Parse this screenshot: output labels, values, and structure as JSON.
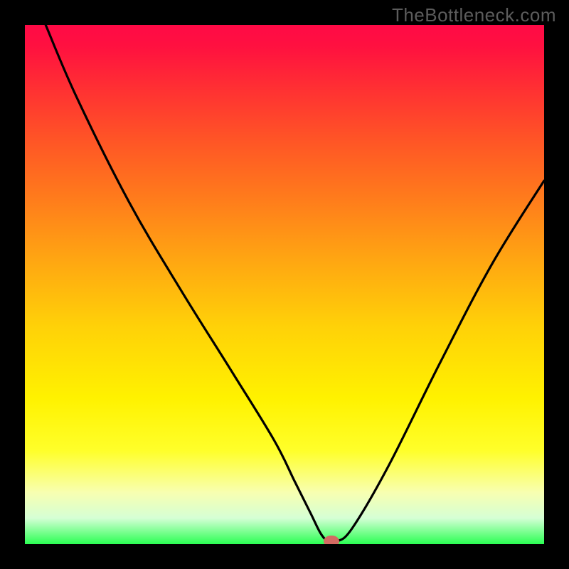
{
  "watermark": "TheBottleneck.com",
  "chart_data": {
    "type": "line",
    "title": "",
    "xlabel": "",
    "ylabel": "",
    "xlim": [
      0,
      100
    ],
    "ylim": [
      0,
      100
    ],
    "series": [
      {
        "name": "curve",
        "x": [
          4,
          10,
          20,
          30,
          40,
          48,
          52,
          55,
          57,
          58.5,
          60,
          63,
          70,
          80,
          90,
          100
        ],
        "values": [
          100,
          86,
          66,
          49,
          33,
          20,
          12,
          6,
          2,
          0.5,
          0.5,
          3,
          15,
          35,
          54,
          70
        ]
      }
    ],
    "marker": {
      "x": 59,
      "y": 0.5,
      "color": "#d46a62"
    },
    "background": {
      "stops": [
        {
          "pos": 0,
          "color": "#ff0a46"
        },
        {
          "pos": 12,
          "color": "#ff2f33"
        },
        {
          "pos": 33,
          "color": "#ff7a1c"
        },
        {
          "pos": 58,
          "color": "#ffd108"
        },
        {
          "pos": 82,
          "color": "#ffff2a"
        },
        {
          "pos": 100,
          "color": "#2bff53"
        }
      ]
    }
  }
}
